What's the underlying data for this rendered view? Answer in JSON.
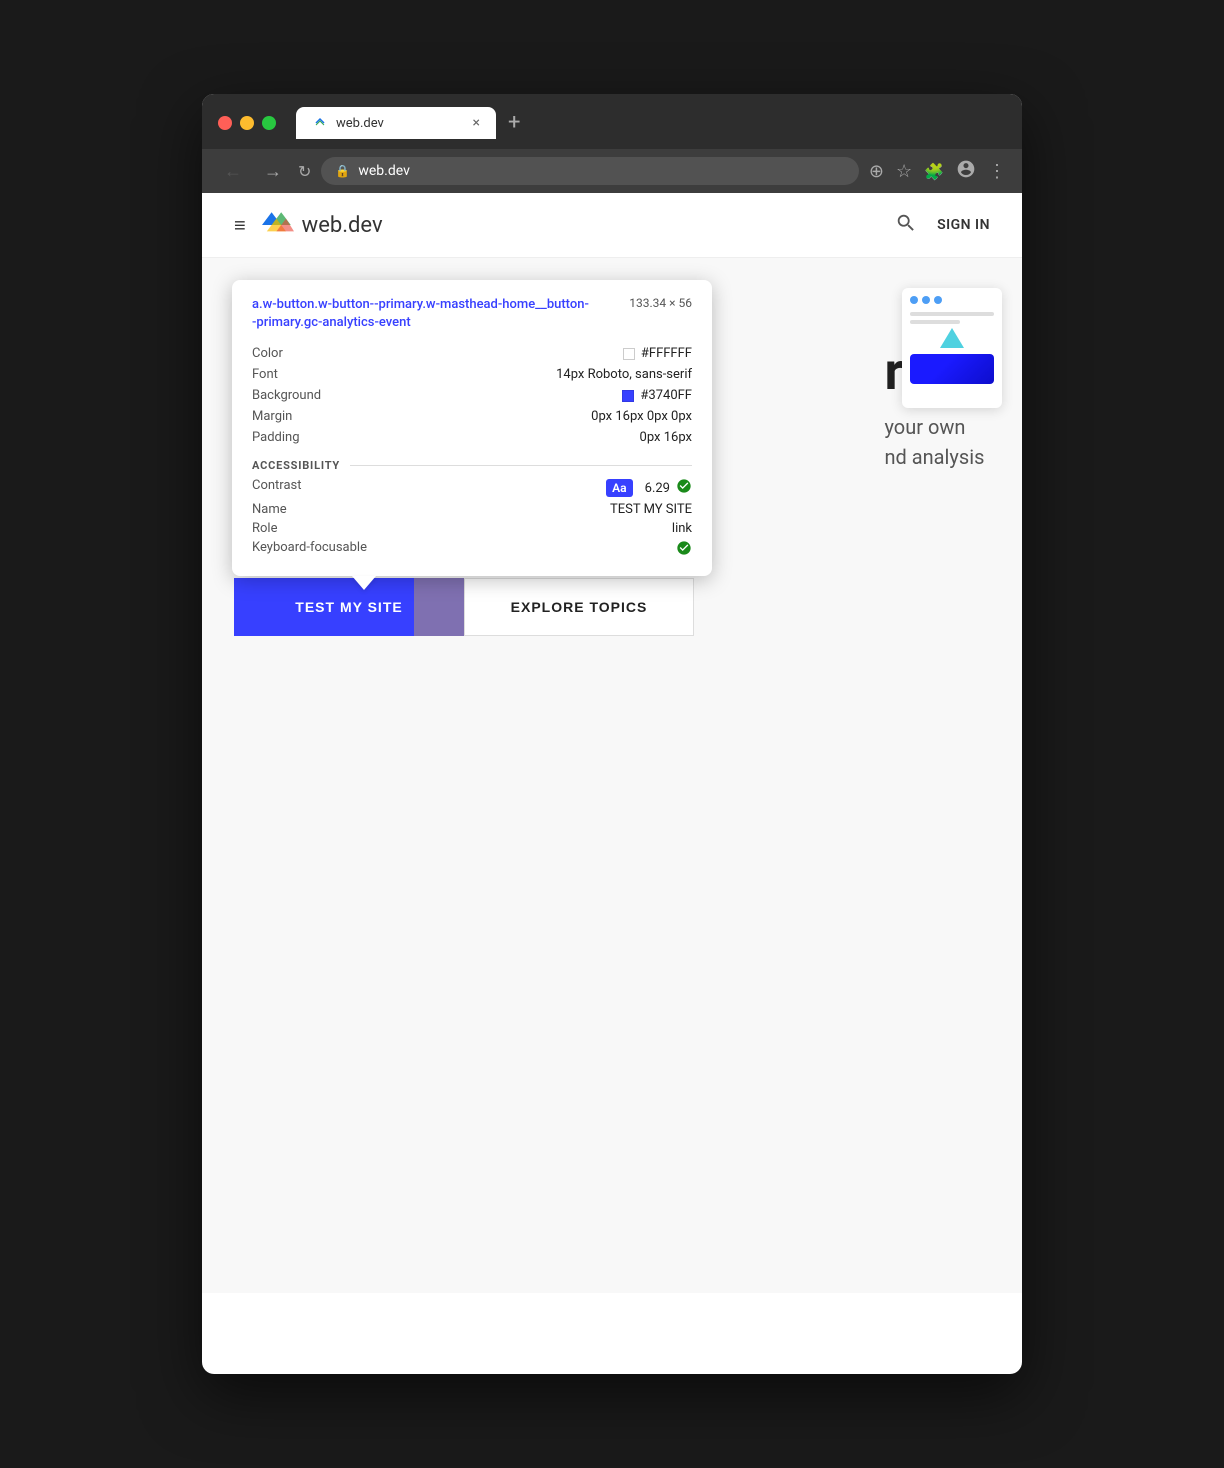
{
  "browser": {
    "traffic_close": "close",
    "traffic_minimize": "minimize",
    "traffic_maximize": "maximize",
    "tab_title": "web.dev",
    "tab_close": "×",
    "tab_new": "+",
    "back_btn": "←",
    "forward_btn": "→",
    "reload_btn": "↻",
    "address": "web.dev",
    "zoom_icon": "⊕",
    "bookmark_icon": "☆",
    "extensions_icon": "🧩",
    "account_icon": "⊙",
    "menu_icon": "⋮"
  },
  "site_header": {
    "hamburger": "≡",
    "logo_alt": "web.dev logo",
    "site_name": "web.dev",
    "search_icon": "🔍",
    "sign_in": "SIGN IN"
  },
  "hero": {
    "text_partial_1": "re of",
    "text_partial_2": "your own",
    "text_partial_3": "nd analysis"
  },
  "tooltip": {
    "selector": "a.w-button.w-button--primary.w-masthead-home__button--primary.gc-analytics-event",
    "dimensions": "133.34 × 56",
    "properties": {
      "color_label": "Color",
      "color_value": "#FFFFFF",
      "font_label": "Font",
      "font_value": "14px Roboto, sans-serif",
      "background_label": "Background",
      "background_value": "#3740FF",
      "background_color": "#3740FF",
      "margin_label": "Margin",
      "margin_value": "0px 16px 0px 0px",
      "padding_label": "Padding",
      "padding_value": "0px 16px"
    },
    "accessibility": {
      "section_label": "ACCESSIBILITY",
      "contrast_label": "Contrast",
      "contrast_badge": "Aa",
      "contrast_value": "6.29",
      "contrast_check": "✓",
      "name_label": "Name",
      "name_value": "TEST MY SITE",
      "role_label": "Role",
      "role_value": "link",
      "keyboard_label": "Keyboard-focusable",
      "keyboard_check": "✓"
    }
  },
  "buttons": {
    "primary_label": "TEST MY SITE",
    "secondary_label": "EXPLORE TOPICS"
  },
  "preview": {
    "dot1_color": "#4d9ef5",
    "dot2_color": "#4d9ef5",
    "dot3_color": "#4d9ef5"
  }
}
